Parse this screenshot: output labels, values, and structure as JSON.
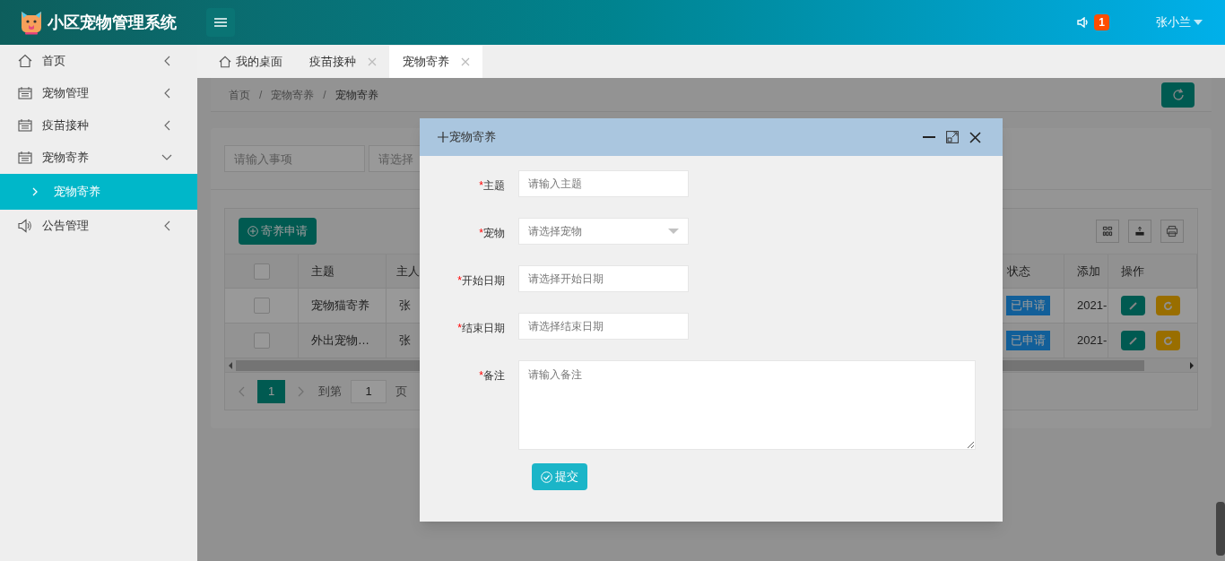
{
  "header": {
    "title": "小区宠物管理系统",
    "notification_count": "1",
    "user": "张小兰"
  },
  "sidebar": {
    "items": [
      {
        "label": "首页",
        "kind": "home",
        "expanded": false
      },
      {
        "label": "宠物管理",
        "kind": "module",
        "expanded": false
      },
      {
        "label": "疫苗接种",
        "kind": "module",
        "expanded": false
      },
      {
        "label": "宠物寄养",
        "kind": "module",
        "expanded": true,
        "children": [
          {
            "label": "宠物寄养",
            "selected": true
          }
        ]
      },
      {
        "label": "公告管理",
        "kind": "notice",
        "expanded": false
      }
    ]
  },
  "tabs": [
    {
      "label": "我的桌面",
      "kind": "home",
      "selected": false
    },
    {
      "label": "疫苗接种",
      "kind": "page",
      "selected": false
    },
    {
      "label": "宠物寄养",
      "kind": "page",
      "selected": true
    }
  ],
  "breadcrumb": [
    {
      "kind": "link",
      "text": "首页"
    },
    {
      "kind": "separator",
      "text": "/"
    },
    {
      "kind": "link",
      "text": "宠物寄养"
    },
    {
      "kind": "separator",
      "text": "/"
    },
    {
      "kind": "current",
      "text": "宠物寄养"
    }
  ],
  "search_fields": [
    {
      "placeholder": "请输入事项"
    },
    {
      "placeholder": "请选择"
    }
  ],
  "table": {
    "add_button": "寄养申请",
    "all_checked": false,
    "columns": [
      "主题",
      "主人",
      "状态",
      "添加",
      "操作"
    ],
    "rows": [
      {
        "checked": false,
        "cells": [
          "宠物猫寄养",
          "张",
          "已申请",
          "2021-"
        ]
      },
      {
        "checked": false,
        "cells": [
          "外出宠物…",
          "张",
          "已申请",
          "2021-"
        ]
      }
    ],
    "pagination": {
      "current": "1",
      "goto_label": "到第",
      "goto_value": "1",
      "page_label": "页"
    }
  },
  "dialog": {
    "title": "宠物寄养",
    "fields": [
      {
        "label": "主题",
        "kind": "text",
        "required_mark": "*",
        "placeholder": "请输入主题"
      },
      {
        "label": "宠物",
        "kind": "select",
        "required_mark": "*",
        "placeholder": "请选择宠物"
      },
      {
        "label": "开始日期",
        "kind": "text",
        "required_mark": "*",
        "placeholder": "请选择开始日期"
      },
      {
        "label": "结束日期",
        "kind": "text",
        "required_mark": "*",
        "placeholder": "请选择结束日期"
      },
      {
        "label": "备注",
        "kind": "textarea",
        "required_mark": "*",
        "placeholder": "请输入备注"
      }
    ],
    "submit": "提交"
  }
}
